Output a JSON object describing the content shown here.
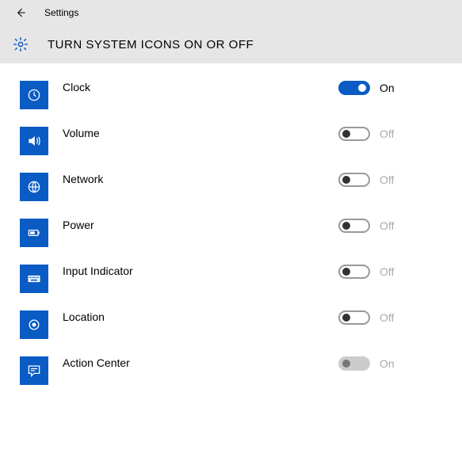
{
  "header": {
    "back_aria": "Back",
    "app_title": "Settings"
  },
  "page": {
    "title": "TURN SYSTEM ICONS ON OR OFF"
  },
  "colors": {
    "accent": "#0a5bc4"
  },
  "labels": {
    "on": "On",
    "off": "Off"
  },
  "items": [
    {
      "label": "Clock",
      "icon": "clock-icon",
      "state": "on",
      "text": "On"
    },
    {
      "label": "Volume",
      "icon": "volume-icon",
      "state": "off",
      "text": "Off"
    },
    {
      "label": "Network",
      "icon": "network-icon",
      "state": "off",
      "text": "Off"
    },
    {
      "label": "Power",
      "icon": "power-icon",
      "state": "off",
      "text": "Off"
    },
    {
      "label": "Input Indicator",
      "icon": "keyboard-icon",
      "state": "off",
      "text": "Off"
    },
    {
      "label": "Location",
      "icon": "location-icon",
      "state": "off",
      "text": "Off"
    },
    {
      "label": "Action Center",
      "icon": "action-center-icon",
      "state": "disabled",
      "text": "On"
    }
  ]
}
